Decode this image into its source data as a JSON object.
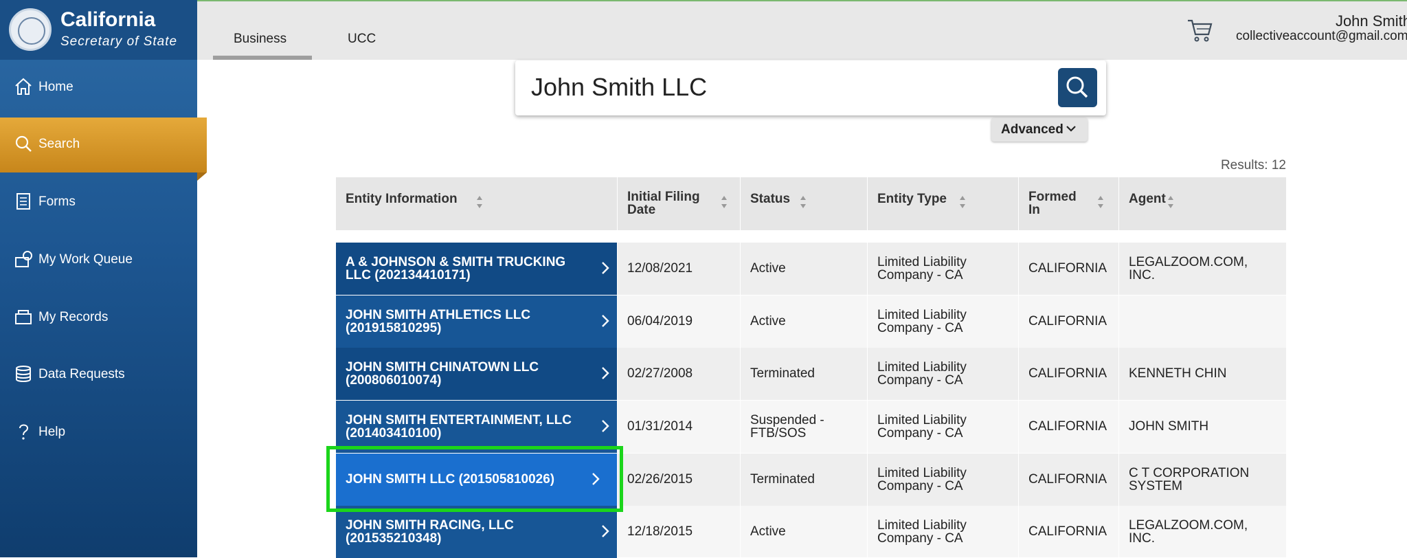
{
  "brand": {
    "title": "California",
    "subtitle": "Secretary of State"
  },
  "nav": [
    {
      "label": "Home",
      "icon": "home-icon"
    },
    {
      "label": "Search",
      "icon": "search-icon",
      "active": true
    },
    {
      "label": "Forms",
      "icon": "forms-icon"
    },
    {
      "label": "My Work Queue",
      "icon": "work-queue-icon"
    },
    {
      "label": "My Records",
      "icon": "records-icon"
    },
    {
      "label": "Data Requests",
      "icon": "database-icon"
    },
    {
      "label": "Help",
      "icon": "help-icon"
    }
  ],
  "tabs": [
    {
      "label": "Business",
      "active": true
    },
    {
      "label": "UCC"
    }
  ],
  "user": {
    "name": "John Smith",
    "email": "collectiveaccount@gmail.com"
  },
  "search": {
    "value": "John Smith LLC"
  },
  "advanced_label": "Advanced",
  "results_label": "Results: 12",
  "table": {
    "headers": [
      "Entity Information",
      "Initial Filing Date",
      "Status",
      "Entity Type",
      "Formed In",
      "Agent"
    ],
    "rows": [
      {
        "entity": "A & JOHNSON & SMITH TRUCKING LLC (202134410171)",
        "date": "12/08/2021",
        "status": "Active",
        "type": "Limited Liability Company - CA",
        "formed": "CALIFORNIA",
        "agent": "LEGALZOOM.COM, INC."
      },
      {
        "entity": "JOHN SMITH ATHLETICS LLC (201915810295)",
        "date": "06/04/2019",
        "status": "Active",
        "type": "Limited Liability Company - CA",
        "formed": "CALIFORNIA",
        "agent": ""
      },
      {
        "entity": "JOHN SMITH CHINATOWN LLC (200806010074)",
        "date": "02/27/2008",
        "status": "Terminated",
        "type": "Limited Liability Company - CA",
        "formed": "CALIFORNIA",
        "agent": "KENNETH CHIN"
      },
      {
        "entity": "JOHN SMITH ENTERTAINMENT, LLC (201403410100)",
        "date": "01/31/2014",
        "status": "Suspended - FTB/SOS",
        "type": "Limited Liability Company - CA",
        "formed": "CALIFORNIA",
        "agent": "JOHN SMITH"
      },
      {
        "entity": "JOHN SMITH LLC (201505810026)",
        "date": "02/26/2015",
        "status": "Terminated",
        "type": "Limited Liability Company - CA",
        "formed": "CALIFORNIA",
        "agent": "C T CORPORATION SYSTEM",
        "highlighted": true
      },
      {
        "entity": "JOHN SMITH RACING, LLC (201535210348)",
        "date": "12/18/2015",
        "status": "Active",
        "type": "Limited Liability Company - CA",
        "formed": "CALIFORNIA",
        "agent": "LEGALZOOM.COM, INC."
      }
    ]
  },
  "colors": {
    "sidebar": "#1d5691",
    "active_nav": "#d99a2b",
    "entity_cell": "#175696",
    "highlight_border": "#1bd51b",
    "search_button": "#1a4a78"
  }
}
